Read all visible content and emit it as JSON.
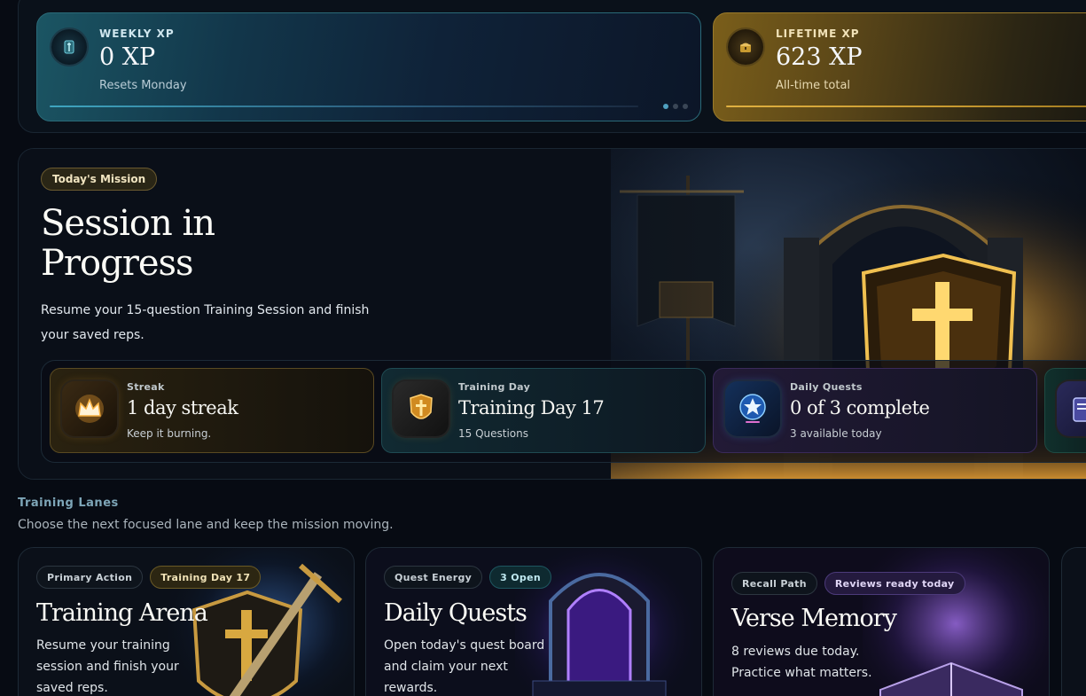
{
  "xp": {
    "weekly": {
      "label": "WEEKLY XP",
      "value": "0 XP",
      "sub": "Resets Monday",
      "icon": "rune-icon"
    },
    "lifetime": {
      "label": "LIFETIME XP",
      "value": "623 XP",
      "sub": "All-time total",
      "icon": "treasure-icon"
    },
    "carousel_active_index": 0,
    "carousel_count": 3
  },
  "hero": {
    "tag": "Today's Mission",
    "title": "Session in Progress",
    "description": "Resume your 15-question Training Session and finish your saved reps."
  },
  "stats": [
    {
      "label": "Streak",
      "value": "1 day streak",
      "sub": "Keep it burning.",
      "icon": "crown-flame-icon"
    },
    {
      "label": "Training Day",
      "value": "Training Day 17",
      "sub": "15 Questions",
      "icon": "shield-icon"
    },
    {
      "label": "Daily Quests",
      "value": "0 of 3 complete",
      "sub": "3 available today",
      "icon": "star-icon"
    }
  ],
  "lanes": {
    "title": "Training Lanes",
    "subtitle": "Choose the next focused lane and keep the mission moving.",
    "cards": [
      {
        "tag1": "Primary Action",
        "tag2": "Training Day 17",
        "title": "Training Arena",
        "desc": "Resume your training session and finish your saved reps."
      },
      {
        "tag1": "Quest Energy",
        "tag2": "3 Open",
        "title": "Daily Quests",
        "desc": "Open today's quest board and claim your next rewards."
      },
      {
        "tag1": "Recall Path",
        "tag2": "Reviews ready today",
        "title": "Verse Memory",
        "desc": "8 reviews due today. Practice what matters."
      }
    ]
  },
  "colors": {
    "teal": "#3fa6c0",
    "gold": "#e0b040",
    "purple": "#7a5ad0",
    "background": "#070b13"
  }
}
